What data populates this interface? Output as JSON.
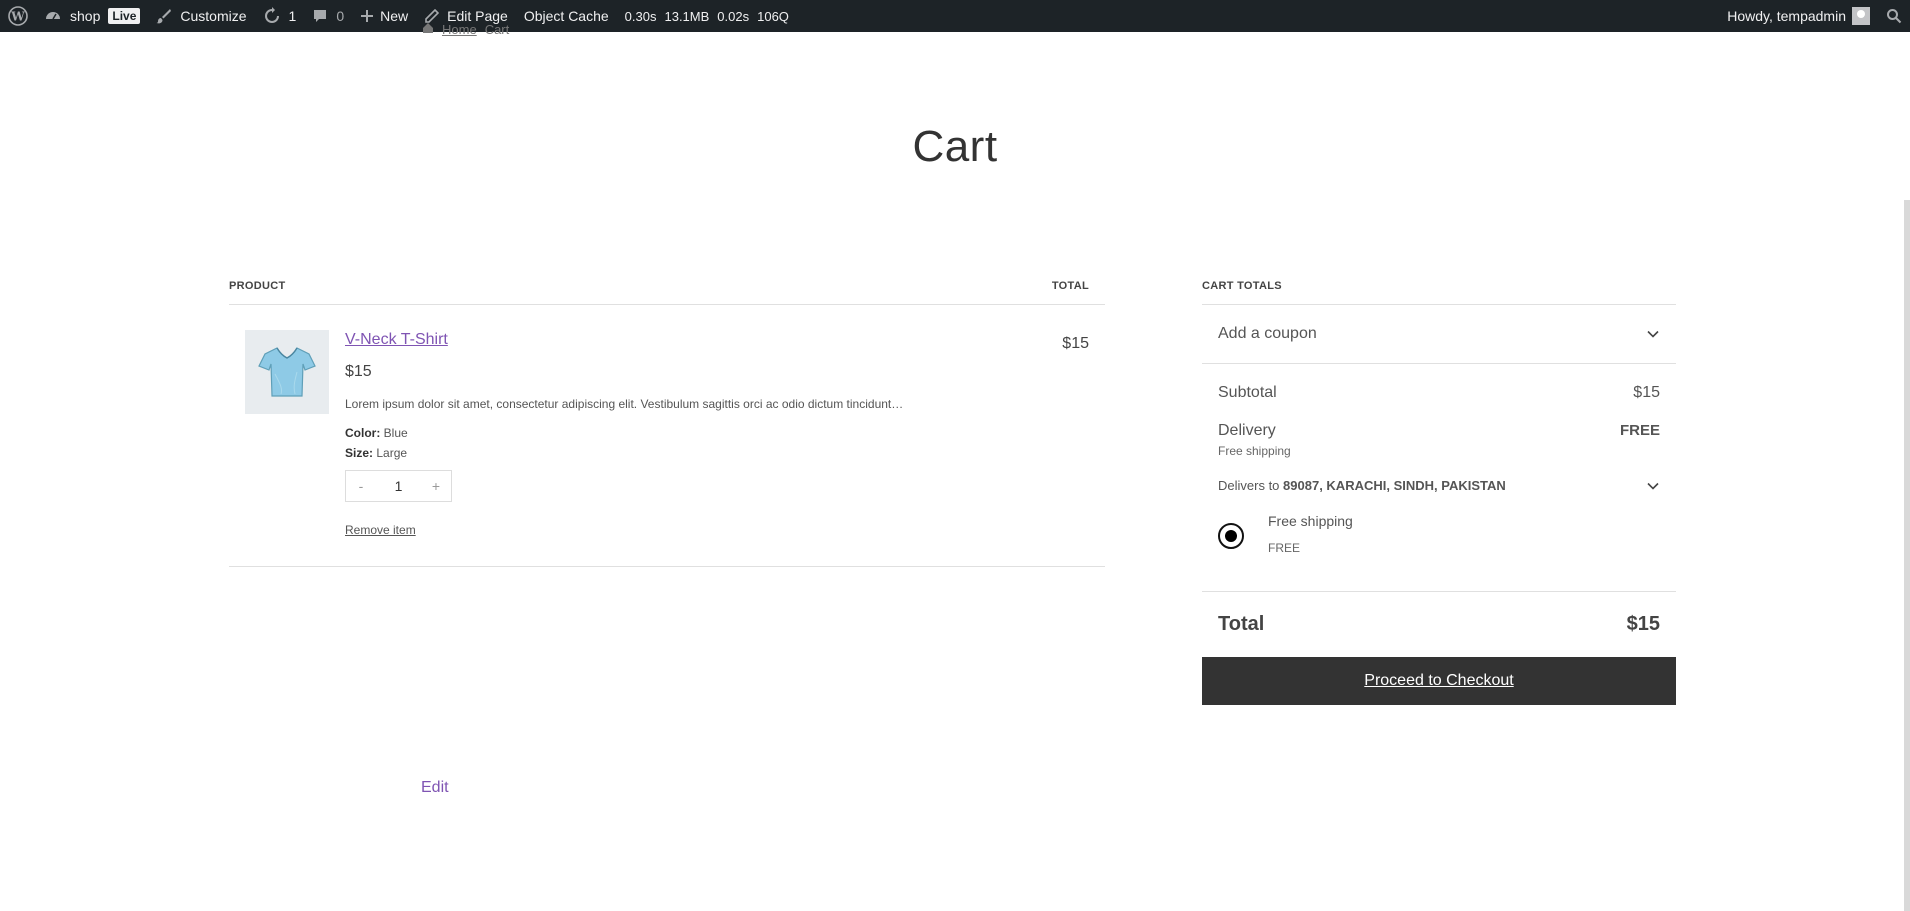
{
  "adminbar": {
    "site_name": "shop",
    "live_badge": "Live",
    "customize": "Customize",
    "updates_count": "1",
    "comments_count": "0",
    "new_label": "New",
    "edit_page": "Edit Page",
    "object_cache": "Object Cache",
    "stats": {
      "time": "0.30s",
      "memory": "13.1MB",
      "query_time": "0.02s",
      "queries": "106Q"
    },
    "howdy": "Howdy, tempadmin"
  },
  "breadcrumb": {
    "home": "Home",
    "current": "Cart"
  },
  "page": {
    "title": "Cart",
    "edit_link": "Edit"
  },
  "cart_table": {
    "col_product": "PRODUCT",
    "col_total": "TOTAL",
    "items": [
      {
        "name": "V-Neck T-Shirt",
        "price": "$15",
        "description": "Lorem ipsum dolor sit amet, consectetur adipiscing elit. Vestibulum sagittis orci ac odio dictum tincidunt…",
        "color_label": "Color:",
        "color_value": "Blue",
        "size_label": "Size:",
        "size_value": "Large",
        "quantity": "1",
        "qty_minus": "-",
        "qty_plus": "+",
        "remove_label": "Remove item",
        "line_total": "$15"
      }
    ]
  },
  "cart_totals": {
    "heading": "CART TOTALS",
    "coupon_label": "Add a coupon",
    "subtotal_label": "Subtotal",
    "subtotal_value": "$15",
    "delivery_label": "Delivery",
    "delivery_value": "FREE",
    "delivery_method": "Free shipping",
    "delivers_to_prefix": "Delivers to",
    "delivers_to_address": "89087, KARACHI, SINDH, PAKISTAN",
    "shipping_option_name": "Free shipping",
    "shipping_option_price": "FREE",
    "total_label": "Total",
    "total_value": "$15",
    "checkout_label": "Proceed to Checkout"
  },
  "colors": {
    "adminbar_bg": "#1d2327",
    "link_purple": "#7f54b3",
    "checkout_bg": "#333333"
  }
}
